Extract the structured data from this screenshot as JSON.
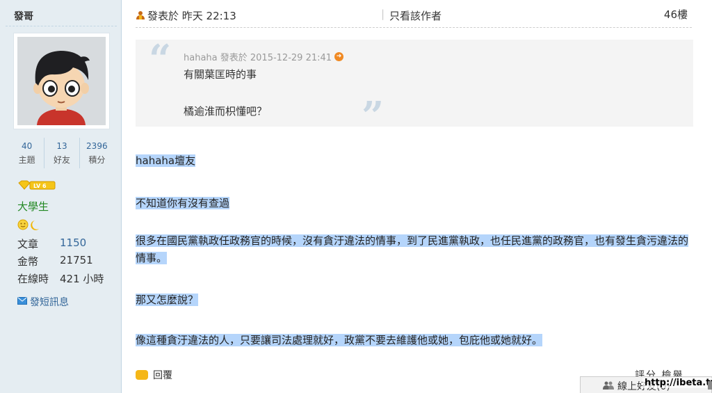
{
  "author": {
    "name": "發哥",
    "stats": [
      {
        "value": "40",
        "label": "主題"
      },
      {
        "value": "13",
        "label": "好友"
      },
      {
        "value": "2396",
        "label": "積分"
      }
    ],
    "level_badge": "LV 6",
    "rank": "大學生",
    "info": [
      {
        "label": "文章",
        "value": "1150"
      },
      {
        "label": "金幣",
        "value": "21751"
      },
      {
        "label": "在線時",
        "value": "421 小時"
      }
    ],
    "pm_label": "發短訊息"
  },
  "post": {
    "posted_label": "發表於 昨天 22:13",
    "separator": "|",
    "author_only": "只看該作者",
    "floor": "46樓",
    "quote": {
      "meta": "hahaha 發表於 2015-12-29 21:41",
      "line1": "有關葉匡時的事",
      "line2": "橘逾淮而枳懂吧？"
    },
    "paragraphs": [
      "hahaha壇友",
      "不知道你有沒有查過",
      "很多在國民黨執政任政務官的時候，沒有貪汙違法的情事，到了民進黨執政，也任民進黨的政務官，也有發生貪污違法的情事。",
      "那又怎麼說？",
      "像這種貪汙違法的人，只要讓司法處理就好，政黨不要去維護他或她，包庇他或她就好。"
    ],
    "reply_label": "回覆",
    "rate_label": "評分 檢舉"
  },
  "online_bar": {
    "label": "線上好友(0)"
  },
  "watermark": "http://ibeta.tw",
  "colors": {
    "sidebar_bg": "#e5edf2",
    "highlight": "#b5d5fb",
    "link": "#336699",
    "rank": "#228822"
  }
}
